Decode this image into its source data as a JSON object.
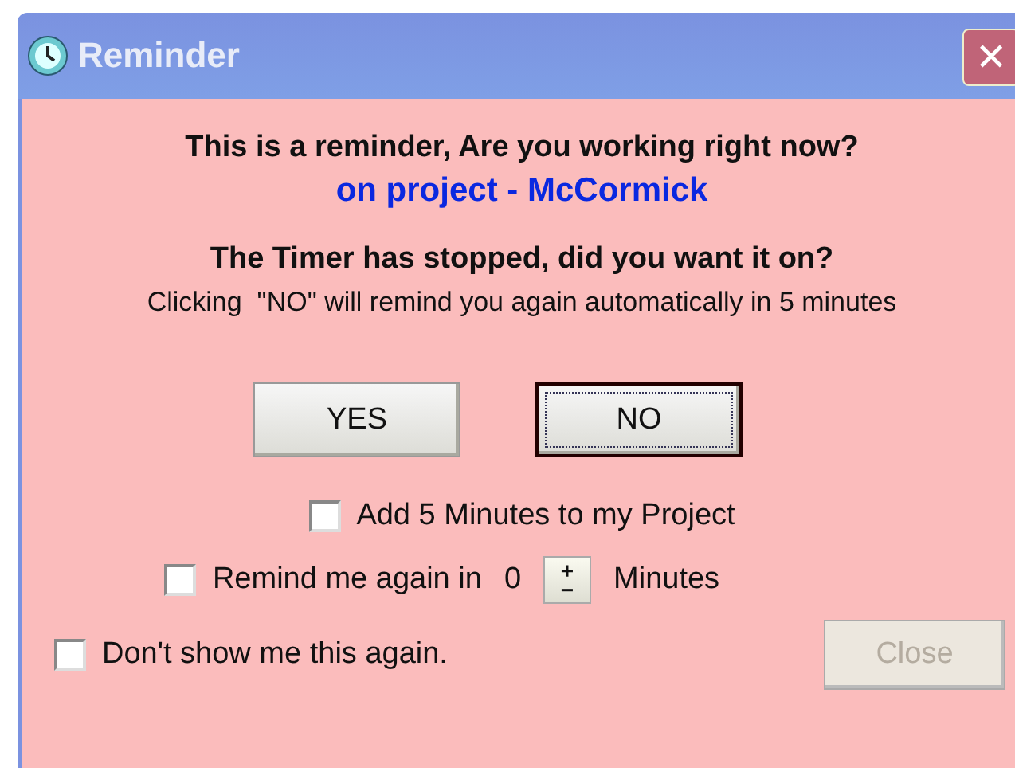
{
  "window": {
    "title": "Reminder",
    "close_glyph": "✕"
  },
  "message": {
    "question": "This is a reminder, Are you working right now?",
    "project": "on project - McCormick",
    "timer": "The Timer has stopped, did you want it on?",
    "note": "Clicking  \"NO\" will remind you again automatically in 5 minutes"
  },
  "buttons": [
    {
      "label": "YES",
      "focused": false
    },
    {
      "label": "NO",
      "focused": true
    }
  ],
  "add_minutes": {
    "label": "Add 5 Minutes to my Project",
    "checked": false
  },
  "remind": {
    "label": "Remind me again in",
    "checked": false,
    "value": "0",
    "spin_up": "+",
    "spin_down": "−",
    "unit": "Minutes"
  },
  "dont_show": {
    "label": "Don't show me this again.",
    "checked": false
  },
  "close_button": {
    "label": "Close",
    "disabled": true
  }
}
